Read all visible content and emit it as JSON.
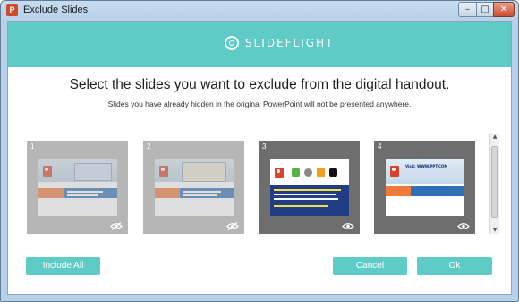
{
  "window": {
    "title": "Exclude Slides",
    "app_icon_letter": "P",
    "controls": {
      "minimize": "–",
      "maximize": "□",
      "close": "✕"
    }
  },
  "header": {
    "brand": "SLIDEFLIGHT",
    "color": "#5ecbc7"
  },
  "main": {
    "heading": "Select the slides you want to exclude from the digital handout.",
    "subheading": "Slides you have already hidden in the original PowerPoint will not be presented anywhere."
  },
  "slides": [
    {
      "number": "1",
      "state": "excluded",
      "visibility_icon": "eye-slash-icon"
    },
    {
      "number": "2",
      "state": "excluded",
      "visibility_icon": "eye-slash-icon"
    },
    {
      "number": "3",
      "state": "included",
      "visibility_icon": "eye-icon"
    },
    {
      "number": "4",
      "state": "included",
      "visibility_icon": "eye-icon"
    }
  ],
  "slide4_url_text": "Visit: WWW.PPT.COM",
  "buttons": {
    "include_all": "Include All",
    "cancel": "Cancel",
    "ok": "Ok"
  }
}
